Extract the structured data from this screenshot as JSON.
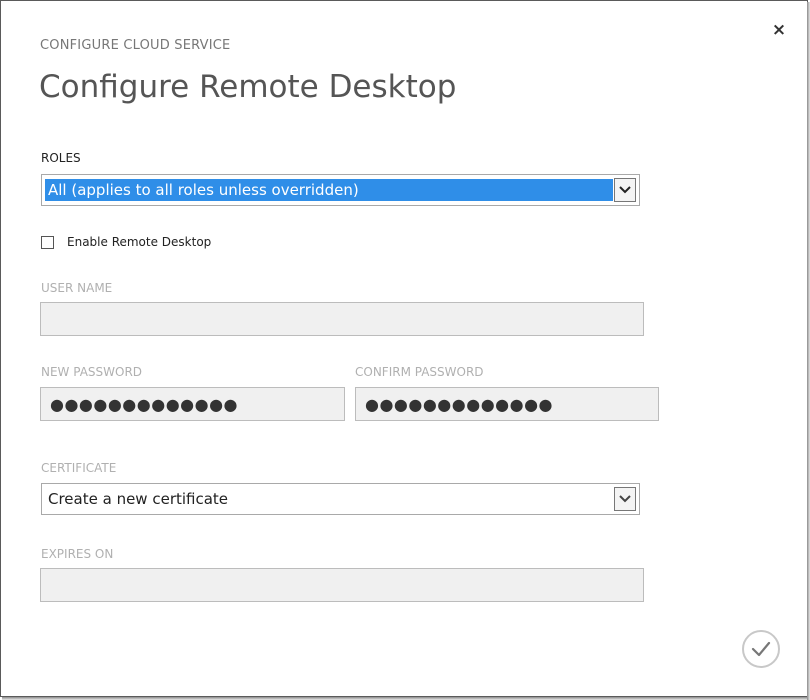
{
  "dialog": {
    "subtitle": "CONFIGURE CLOUD SERVICE",
    "title": "Configure Remote Desktop",
    "close_label": "×"
  },
  "roles": {
    "label": "ROLES",
    "selected": "All (applies to all roles unless overridden)"
  },
  "enable_remote_desktop": {
    "label": "Enable Remote Desktop",
    "checked": false
  },
  "user_name": {
    "label": "USER NAME",
    "value": ""
  },
  "new_password": {
    "label": "NEW PASSWORD",
    "masked_value": "●●●●●●●●●●●●●"
  },
  "confirm_password": {
    "label": "CONFIRM PASSWORD",
    "masked_value": "●●●●●●●●●●●●●"
  },
  "certificate": {
    "label": "CERTIFICATE",
    "selected": "Create a new certificate"
  },
  "expires_on": {
    "label": "EXPIRES ON",
    "value": ""
  },
  "icons": {
    "close": "close-icon",
    "dropdown": "chevron-down-icon",
    "ok": "checkmark-icon"
  },
  "colors": {
    "selection_highlight": "#2f8ee8",
    "disabled_label": "#b0b0b0",
    "disabled_field": "#f0f0f0"
  }
}
